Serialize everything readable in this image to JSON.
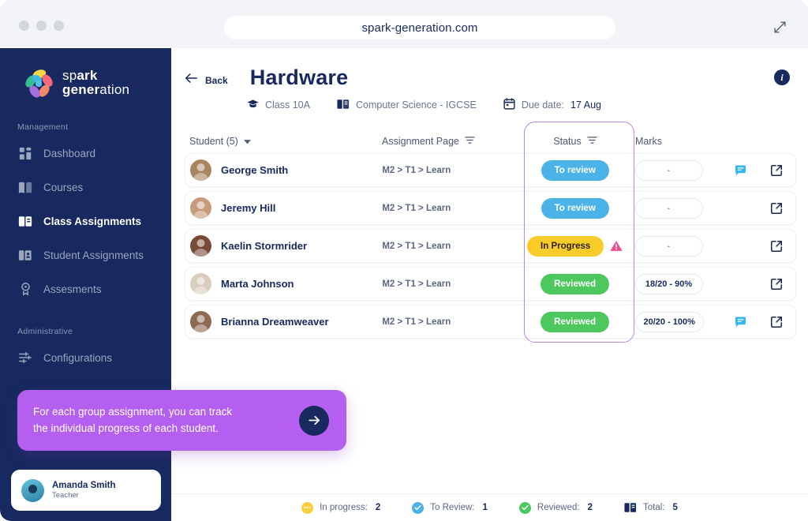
{
  "browser": {
    "url": "spark-generation.com",
    "expand_icon": "expand-diagonal-icon",
    "traffic_lights": 3
  },
  "sidebar": {
    "logo": {
      "line1_light": "sp",
      "line1_bold": "ark",
      "line2_bold": "gener",
      "line2_light": "ation"
    },
    "sections": [
      {
        "label": "Management",
        "items": [
          {
            "label": "Dashboard",
            "icon": "grid-icon",
            "active": false
          },
          {
            "label": "Courses",
            "icon": "book-icon",
            "active": false
          },
          {
            "label": "Class Assignments",
            "icon": "open-book-icon",
            "active": true
          },
          {
            "label": "Student Assignments",
            "icon": "book-person-icon",
            "active": false
          },
          {
            "label": "Assesments",
            "icon": "medal-icon",
            "active": false
          }
        ]
      },
      {
        "label": "Administrative",
        "items": [
          {
            "label": "Configurations",
            "icon": "sliders-icon",
            "active": false
          }
        ]
      }
    ],
    "user": {
      "name": "Amanda Smith",
      "role": "Teacher"
    }
  },
  "callout": {
    "line1": "For each group assignment, you can track",
    "line2": "the individual progress of each student.",
    "next_icon": "arrow-right-icon",
    "color": "#b55ff0"
  },
  "header": {
    "back_label": "Back",
    "title": "Hardware",
    "info_icon": "info-icon",
    "meta": [
      {
        "icon": "graduation-cap-icon",
        "label": "Class 10A"
      },
      {
        "icon": "book-icon",
        "label": "Computer Science - IGCSE"
      },
      {
        "icon": "calendar-icon",
        "label": "Due date:",
        "value": "17 Aug"
      }
    ]
  },
  "table": {
    "columns": [
      {
        "key": "student",
        "label": "Student (5)",
        "icon": "chevron-down-icon"
      },
      {
        "key": "page",
        "label": "Assignment Page",
        "icon": "filter-icon"
      },
      {
        "key": "status",
        "label": "Status",
        "icon": "filter-icon"
      },
      {
        "key": "marks",
        "label": "Marks",
        "icon": null
      }
    ],
    "status_column_highlighted": true,
    "highlight_color": "#bb85e8",
    "rows": [
      {
        "name": "George Smith",
        "page": "M2 > T1 > Learn",
        "status": "To review",
        "status_color": "#4cb3e8",
        "status_text_color": "#ffffff",
        "warning": false,
        "marks": "-",
        "marks_empty": true,
        "has_comment": true,
        "avatar_bg": "#a9845f"
      },
      {
        "name": "Jeremy Hill",
        "page": "M2 > T1 > Learn",
        "status": "To review",
        "status_color": "#4cb3e8",
        "status_text_color": "#ffffff",
        "warning": false,
        "marks": "-",
        "marks_empty": true,
        "has_comment": false,
        "avatar_bg": "#c79a7c"
      },
      {
        "name": "Kaelin Stormrider",
        "page": "M2 > T1 > Learn",
        "status": "In Progress",
        "status_color": "#facc29",
        "status_text_color": "#2c2303",
        "warning": true,
        "marks": "-",
        "marks_empty": true,
        "has_comment": false,
        "avatar_bg": "#7a4a38"
      },
      {
        "name": "Marta Johnson",
        "page": "M2 > T1 > Learn",
        "status": "Reviewed",
        "status_color": "#4cc85f",
        "status_text_color": "#ffffff",
        "warning": false,
        "marks": "18/20 - 90%",
        "marks_empty": false,
        "has_comment": false,
        "avatar_bg": "#d8cdbe"
      },
      {
        "name": "Brianna Dreamweaver",
        "page": "M2 > T1 > Learn",
        "status": "Reviewed",
        "status_color": "#4cc85f",
        "status_text_color": "#ffffff",
        "warning": false,
        "marks": "20/20 - 100%",
        "marks_empty": false,
        "has_comment": true,
        "avatar_bg": "#8d6a52"
      }
    ],
    "row_actions": {
      "comment_icon": "comment-icon",
      "open_icon": "external-link-icon"
    }
  },
  "footer": {
    "stats": [
      {
        "icon": "in-progress-icon",
        "color": "#f9cf3e",
        "label": "In progress:",
        "value": "2"
      },
      {
        "icon": "to-review-icon",
        "color": "#4cb3e8",
        "label": "To Review:",
        "value": "1"
      },
      {
        "icon": "reviewed-icon",
        "color": "#4cc85f",
        "label": "Reviewed:",
        "value": "2"
      },
      {
        "icon": "book-icon",
        "color": "#17295e",
        "label": "Total:",
        "value": "5"
      }
    ]
  }
}
